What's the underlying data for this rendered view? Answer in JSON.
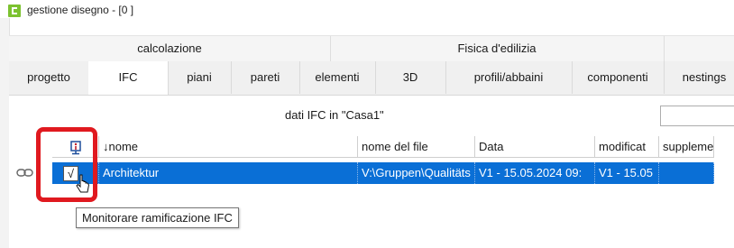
{
  "window": {
    "title": "gestione disegno - [0  ]"
  },
  "group_tabs": [
    "calcolazione",
    "Fisica d'edilizia"
  ],
  "tabs": [
    {
      "label": "progetto",
      "active": false
    },
    {
      "label": "IFC",
      "active": true
    },
    {
      "label": "piani",
      "active": false
    },
    {
      "label": "pareti",
      "active": false
    },
    {
      "label": "elementi",
      "active": false
    },
    {
      "label": "3D",
      "active": false
    },
    {
      "label": "profili/abbaini",
      "active": false
    },
    {
      "label": "componenti",
      "active": false
    },
    {
      "label": "nestings",
      "active": false
    }
  ],
  "section": {
    "label": "dati IFC in \"Casa1\""
  },
  "filter": {
    "value": ""
  },
  "table": {
    "columns": [
      {
        "label": "",
        "icon": "monitor-branch-icon"
      },
      {
        "label": "↓nome"
      },
      {
        "label": "nome del file"
      },
      {
        "label": "Data"
      },
      {
        "label": "modificat"
      },
      {
        "label": "suppleme"
      }
    ],
    "rows": [
      {
        "checked": true,
        "check_glyph": "√",
        "nome": "Architektur",
        "file": "V:\\Gruppen\\Qualitäts",
        "data": "V1 - 15.05.2024  09:",
        "modificato": "V1 - 15.05",
        "supplemento": ""
      }
    ]
  },
  "tooltip": {
    "text": "Monitorare ramificazione IFC"
  },
  "colors": {
    "selection": "#0a6fd6",
    "highlight": "#e0191f",
    "app_icon": "#7cc230"
  }
}
